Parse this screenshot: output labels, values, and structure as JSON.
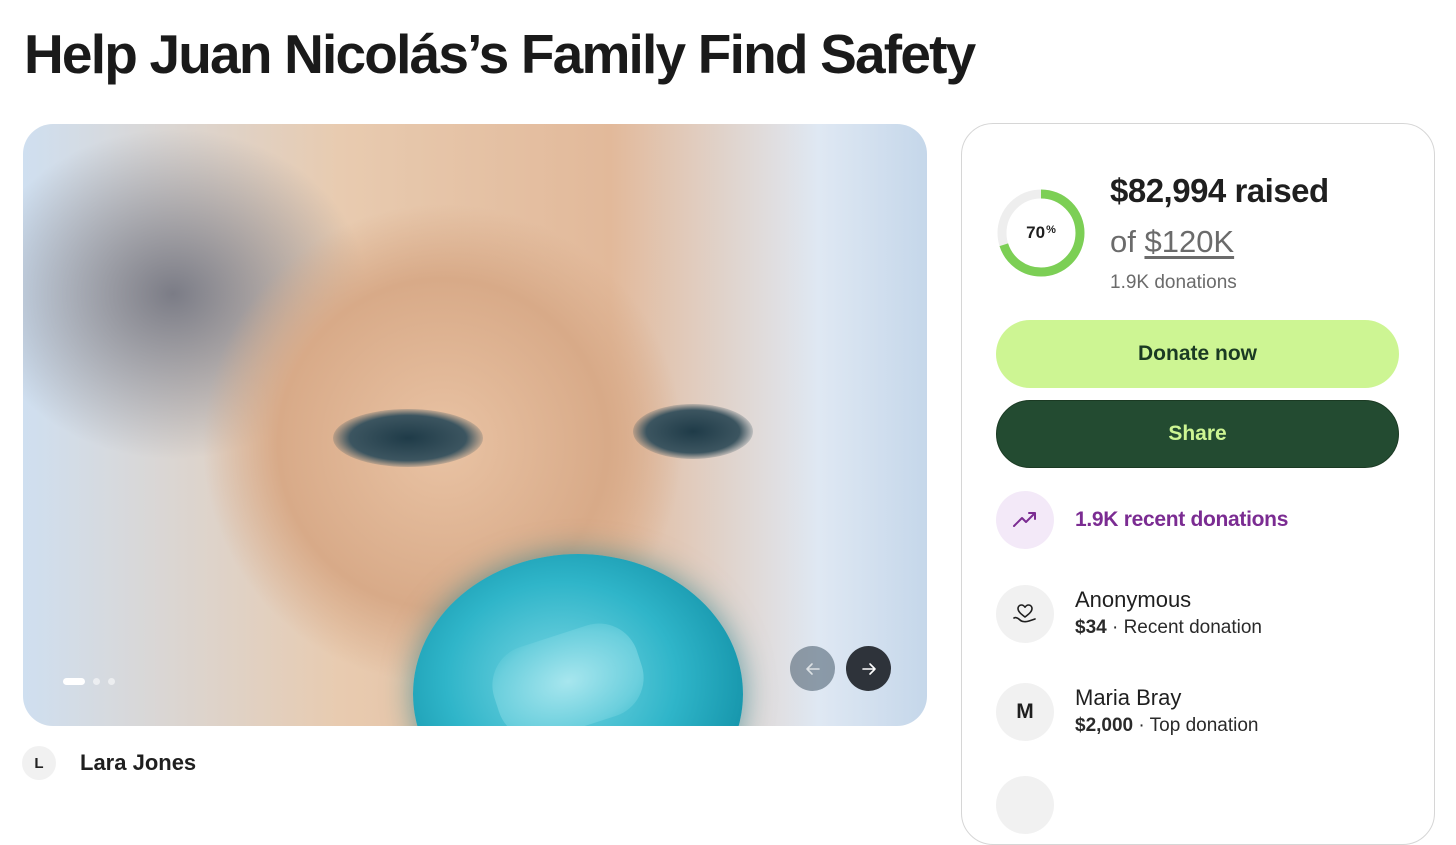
{
  "campaign": {
    "title": "Help Juan Nicolás’s Family Find Safety",
    "organizer": {
      "initial": "L",
      "name": "Lara Jones"
    }
  },
  "gallery": {
    "slide_count": 3,
    "active_slide": 1,
    "prev_icon": "arrow-left-icon",
    "next_icon": "arrow-right-icon"
  },
  "donation_card": {
    "progress_percent": 70,
    "progress_number": "70",
    "progress_symbol": "%",
    "raised": "$82,994 raised",
    "goal_prefix": "of ",
    "goal_amount": "$120K",
    "donation_count": "1.9K donations",
    "donate_label": "Donate now",
    "share_label": "Share",
    "recent_label": "1.9K recent donations",
    "accent_color": "#cdf593",
    "share_color": "#234b31",
    "recent_color": "#7b2c92",
    "donors": [
      {
        "initial": "",
        "icon": "heart-hand-icon",
        "name": "Anonymous",
        "amount": "$34",
        "note": " · Recent donation"
      },
      {
        "initial": "M",
        "name": "Maria Bray",
        "amount": "$2,000",
        "note": " · Top donation"
      }
    ]
  }
}
